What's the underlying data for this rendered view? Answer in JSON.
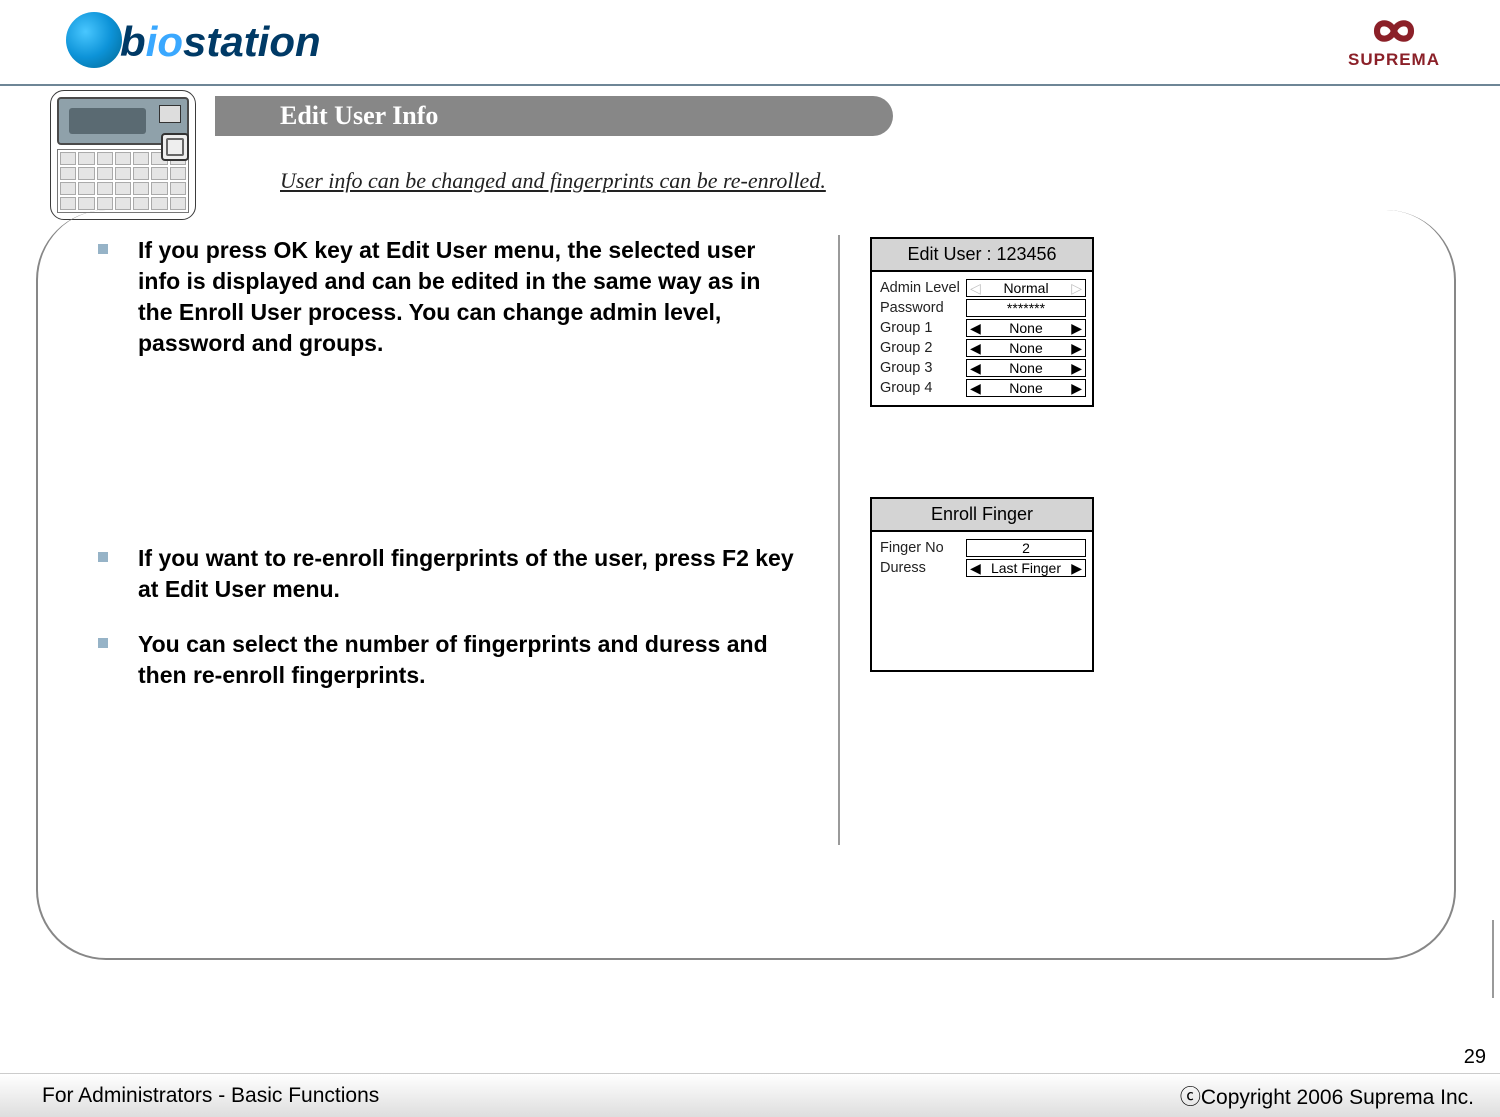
{
  "header": {
    "brand_main": "b",
    "brand_light": "io",
    "brand_rest": "station",
    "suprema_label": "SUPREMA"
  },
  "title_bar": {
    "title": "Edit User Info",
    "subtitle": "User info can be changed and fingerprints can be re-enrolled."
  },
  "bullets": {
    "b1": "If you press OK key at Edit User menu, the selected user info is displayed and can be edited in the same way as in the Enroll User process. You can change admin level, password and groups.",
    "b2": "If you want to re-enroll fingerprints of the user, press F2 key at Edit User menu.",
    "b3": "You can select the number of fingerprints and duress and then re-enroll fingerprints."
  },
  "panel_edit": {
    "title": "Edit User : 123456",
    "rows": {
      "admin_label": "Admin Level",
      "admin_value": "Normal",
      "password_label": "Password",
      "password_value": "*******",
      "g1_label": "Group 1",
      "g1_value": "None",
      "g2_label": "Group 2",
      "g2_value": "None",
      "g3_label": "Group 3",
      "g3_value": "None",
      "g4_label": "Group 4",
      "g4_value": "None"
    }
  },
  "panel_enroll": {
    "title": "Enroll Finger",
    "rows": {
      "finger_label": "Finger No",
      "finger_value": "2",
      "duress_label": "Duress",
      "duress_value": "Last Finger"
    }
  },
  "footer": {
    "left": "For Administrators - Basic Functions",
    "right": "ⓒCopyright 2006 Suprema Inc.",
    "page": "29"
  }
}
